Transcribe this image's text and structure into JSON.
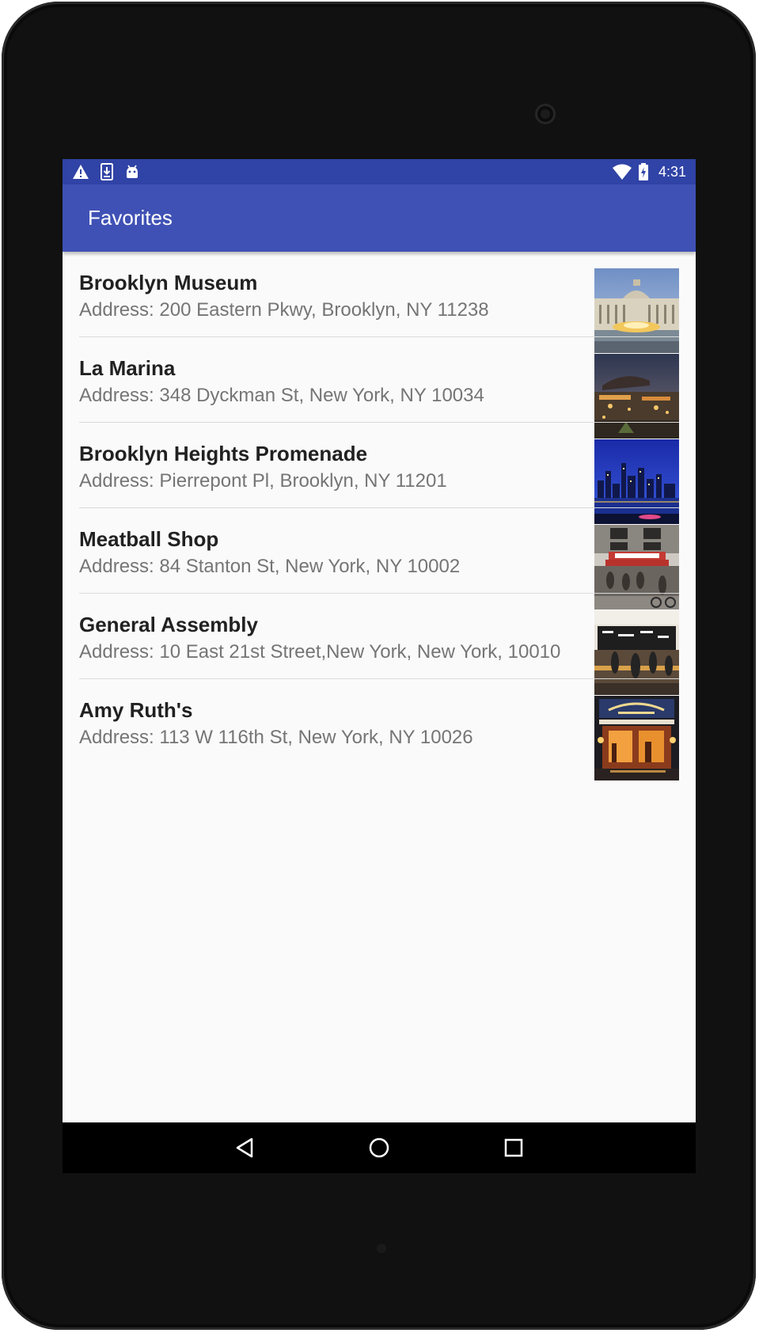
{
  "status_bar": {
    "time": "4:31",
    "notification_icons": [
      "warning-icon",
      "download-icon",
      "android-icon"
    ],
    "system_icons": [
      "wifi-icon",
      "battery-charging-icon"
    ]
  },
  "app_bar": {
    "title": "Favorites",
    "color": "#3f51b5",
    "status_color": "#3043a6"
  },
  "favorites": [
    {
      "name": "Brooklyn Museum",
      "address": "Address: 200 Eastern Pkwy, Brooklyn, NY 11238",
      "thumbnail": "brooklyn-museum-photo"
    },
    {
      "name": "La Marina",
      "address": "Address: 348 Dyckman St, New York, NY 10034",
      "thumbnail": "la-marina-photo"
    },
    {
      "name": "Brooklyn Heights Promenade",
      "address": "Address: Pierrepont Pl, Brooklyn, NY 11201",
      "thumbnail": "brooklyn-heights-promenade-photo"
    },
    {
      "name": "Meatball Shop",
      "address": "Address: 84 Stanton St, New York, NY 10002",
      "thumbnail": "meatball-shop-photo"
    },
    {
      "name": "General Assembly",
      "address": "Address: 10 East 21st Street,New York, New York, 10010",
      "thumbnail": "general-assembly-photo"
    },
    {
      "name": "Amy Ruth's",
      "address": "Address: 113 W 116th St, New York, NY 10026",
      "thumbnail": "amy-ruths-photo"
    }
  ],
  "nav_bar": {
    "buttons": [
      "back-icon",
      "home-icon",
      "recents-icon"
    ]
  }
}
